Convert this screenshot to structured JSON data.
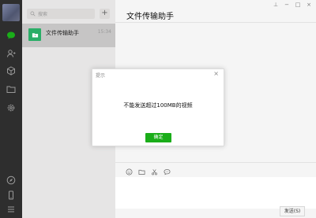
{
  "search": {
    "placeholder": "搜索"
  },
  "list": {
    "add_label": "+",
    "items": [
      {
        "name": "文件传输助手",
        "time": "15:34",
        "icon": "folder-icon"
      }
    ]
  },
  "chat": {
    "title": "文件传输助手"
  },
  "window": {
    "pin": "⊥",
    "min": "−",
    "max": "□",
    "close": "×"
  },
  "toolbar": [
    "emoji-icon",
    "folder-icon",
    "scissors-icon",
    "chat-bubble-icon"
  ],
  "input": {
    "send_label": "发送(S)"
  },
  "dialog": {
    "title": "提示",
    "close": "×",
    "message": "不能发送超过100MB的视频",
    "ok_label": "确定"
  },
  "colors": {
    "accent": "#1aad19",
    "nav_bg": "#2e2e2e",
    "selected_item": "#c6c5c5"
  },
  "nav_icons": [
    "chat-icon",
    "contacts-icon",
    "box-icon",
    "folder-icon",
    "settings-icon",
    "compass-icon",
    "phone-icon",
    "menu-icon"
  ]
}
